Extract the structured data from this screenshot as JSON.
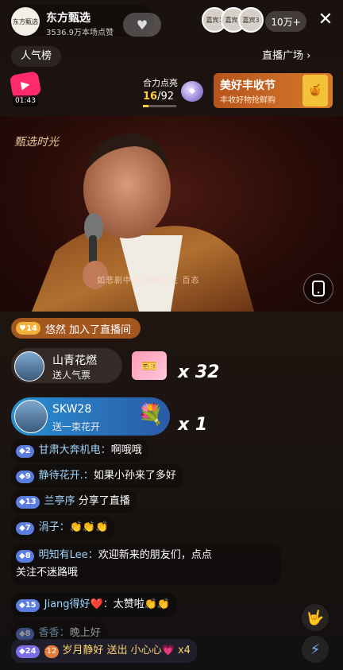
{
  "host": {
    "avatar_text": "东方甄选",
    "name": "东方甄选",
    "likes": "3536.9万本场点赞"
  },
  "header": {
    "follow_icon": "heart-icon",
    "viewers": [
      "嘉宾1",
      "嘉宾2",
      "嘉宾3"
    ],
    "viewer_count": "10万+",
    "close_label": "✕",
    "rank_label": "人气榜",
    "plaza_label": "直播广场 ›"
  },
  "redpacket": {
    "timer": "01:43"
  },
  "cooperate": {
    "label": "合力点亮",
    "current": "16",
    "total": "/92",
    "progress_fraction": 0.174
  },
  "promo": {
    "title": "美好丰收节",
    "subtitle": "丰收好物抢鲜购"
  },
  "video": {
    "logo_text": "甄选时光",
    "lyric": "如悲剧中的 演绎人生 百态"
  },
  "join_banner": {
    "level": "14",
    "user": "悠然",
    "text": "加入了直播间"
  },
  "gifts": [
    {
      "name": "山青花燃",
      "desc": "送人气票",
      "count": "x 32"
    },
    {
      "name": "SKW28",
      "desc": "送一束花开",
      "count": "x 1"
    }
  ],
  "chat": [
    {
      "level": "2",
      "user": "甘肃大奔机电：",
      "text": "啊哦哦"
    },
    {
      "level": "9",
      "user": "静待花开.：",
      "text": "如果小孙来了多好"
    },
    {
      "level": "13",
      "user": "兰亭序",
      "text": "分享了直播"
    },
    {
      "level": "7",
      "user": "涓子：",
      "text": "👏👏👏"
    },
    {
      "level": "8",
      "user": "明知有Lee：",
      "text": "欢迎新来的朋友们，点点",
      "text2": "关注不迷路哦"
    },
    {
      "level": "15",
      "user": "Jiang得好❤️：",
      "text": "太赞啦👏👏"
    },
    {
      "level": "8",
      "user": "香香：",
      "text": "晚上好"
    },
    {
      "level": "24",
      "fan": "12",
      "user": "岁月静好",
      "text": "送出 小心心💗 x4"
    }
  ],
  "colors": {
    "accent_orange": "#a4561f",
    "gift_blue": "#2a8fd0",
    "level_blue": "#5b7de0",
    "username": "#9fd6ff",
    "progress_yellow": "#ffcf3d"
  }
}
